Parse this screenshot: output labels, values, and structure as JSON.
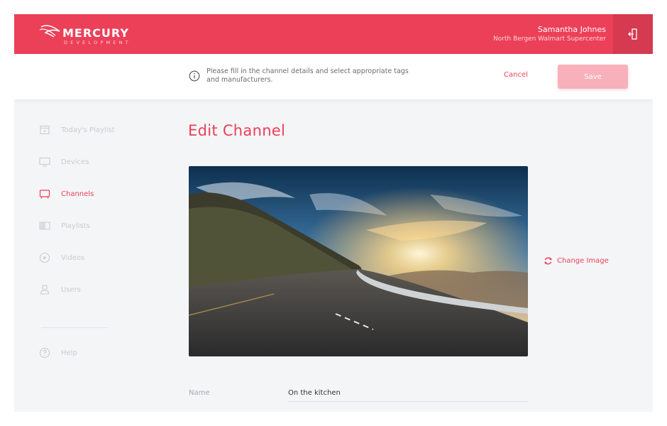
{
  "brand": {
    "name": "MERCURY",
    "tagline": "DEVELOPMENT",
    "accent": "#ec4058"
  },
  "user": {
    "name": "Samantha Johnes",
    "store": "North Bergen Walmart Supercenter"
  },
  "actionbar": {
    "info_line1": "Please fill in the channel details and select appropriate tags",
    "info_line2": "and manufacturers.",
    "cancel_label": "Cancel",
    "save_label": "Save"
  },
  "sidebar": {
    "items": [
      {
        "label": "Today's Playlist",
        "icon": "calendar-icon",
        "active": false
      },
      {
        "label": "Devices",
        "icon": "monitor-icon",
        "active": false
      },
      {
        "label": "Channels",
        "icon": "tv-icon",
        "active": true
      },
      {
        "label": "Playlists",
        "icon": "playlist-icon",
        "active": false
      },
      {
        "label": "Videos",
        "icon": "play-circle-icon",
        "active": false
      },
      {
        "label": "Users",
        "icon": "user-icon",
        "active": false
      }
    ],
    "help_label": "Help"
  },
  "main": {
    "title": "Edit Channel",
    "change_image_label": "Change Image",
    "name_label": "Name",
    "name_value": "On the kitchen"
  }
}
